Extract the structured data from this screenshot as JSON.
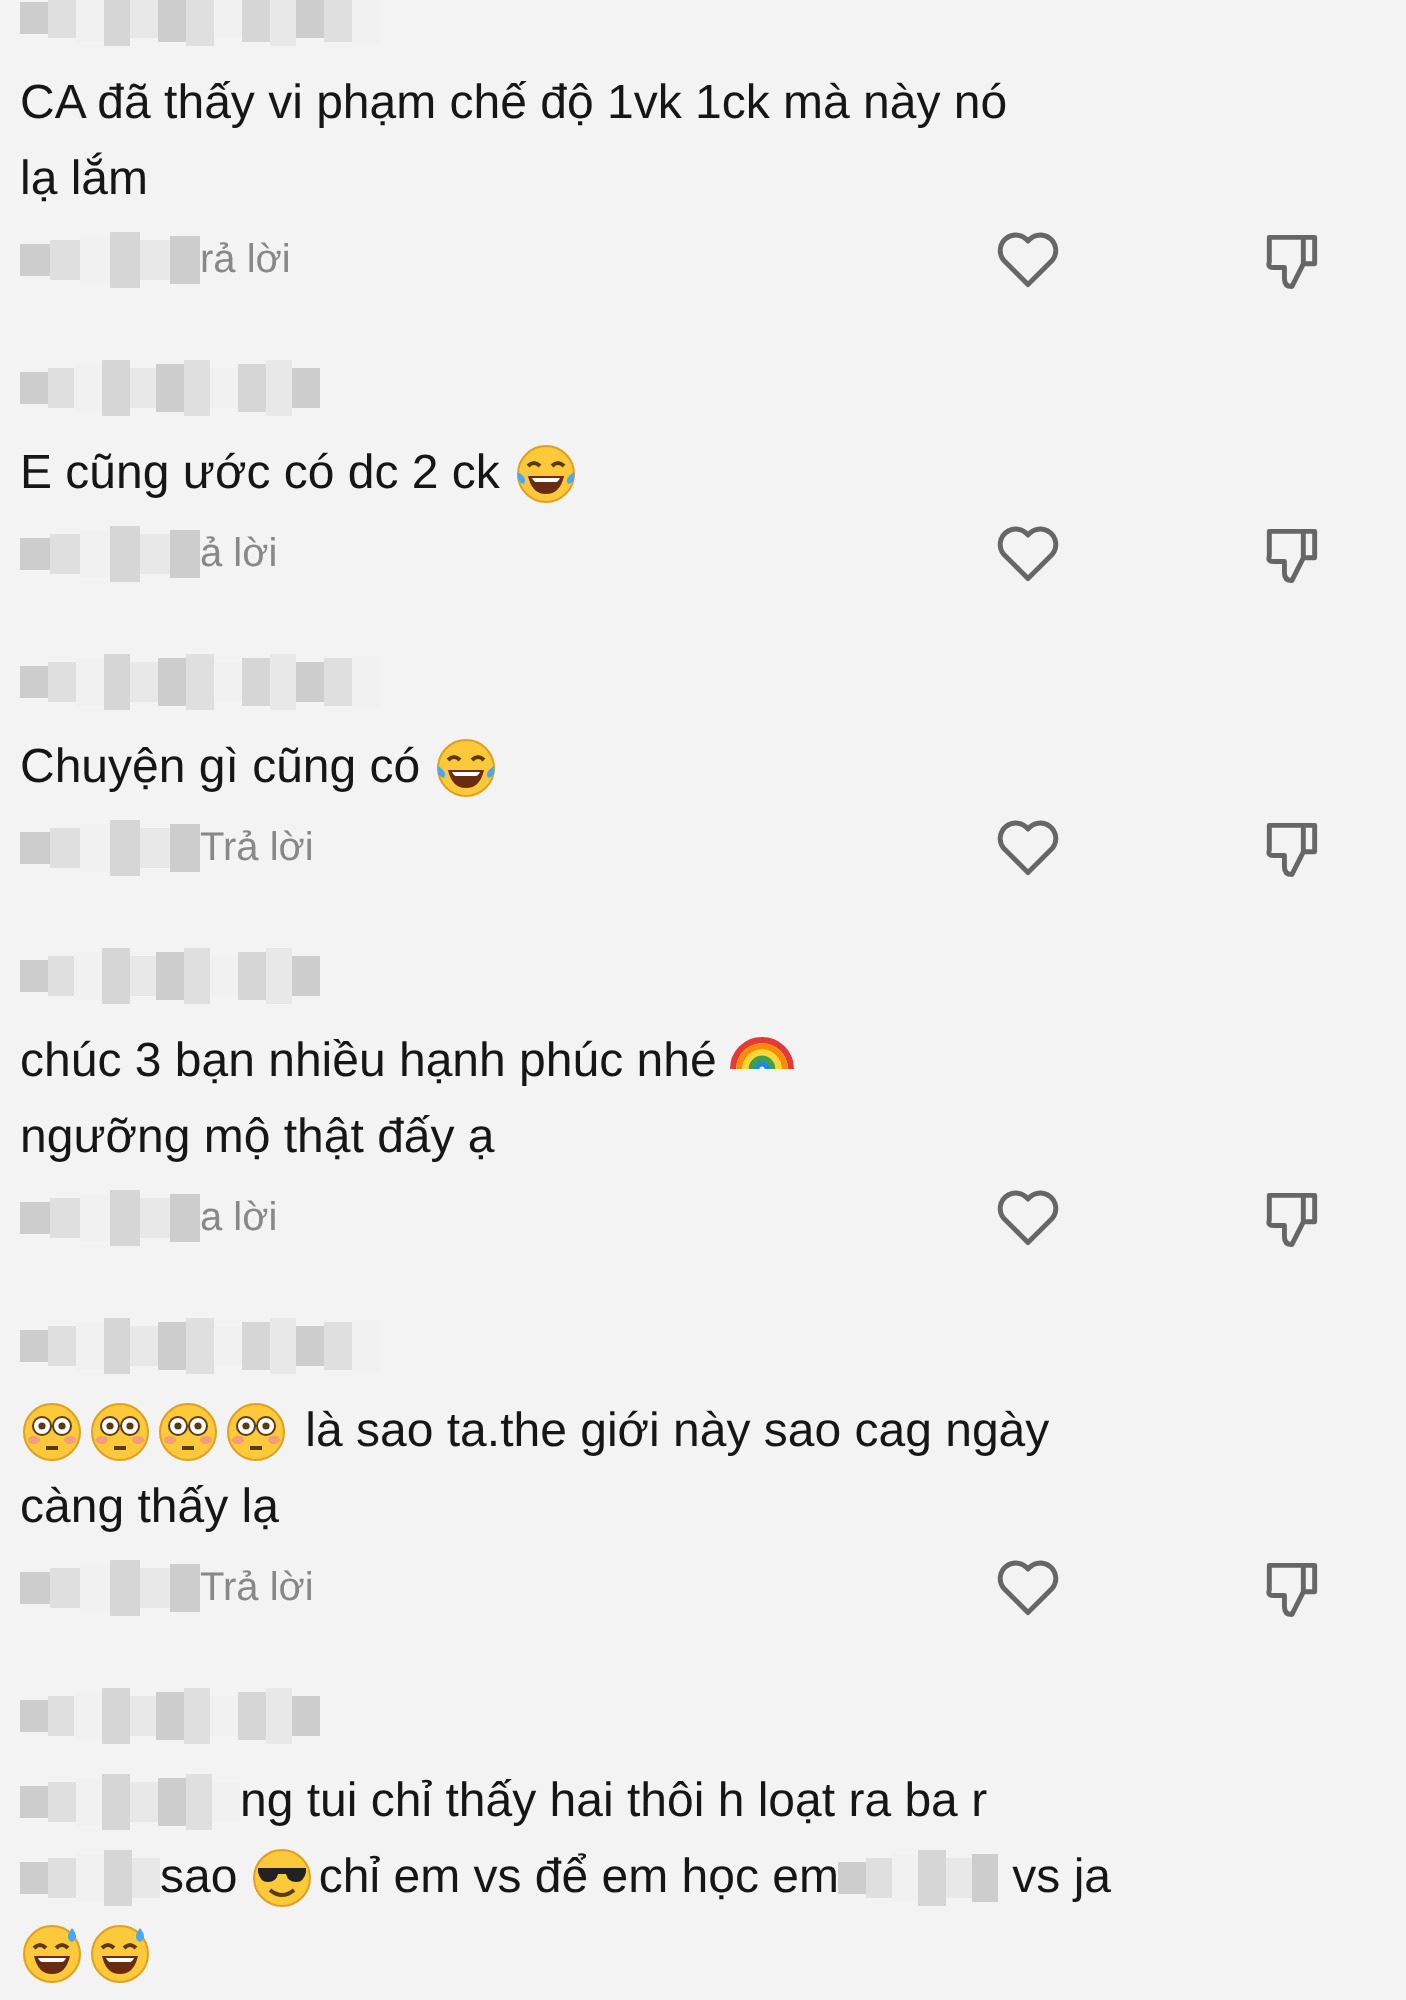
{
  "comments": [
    {
      "lines": [
        [
          {
            "kind": "text",
            "text": "CA đã thấy vi phạm chế độ 1vk 1ck mà này nó"
          }
        ],
        [
          {
            "kind": "text",
            "text": "lạ lắm"
          }
        ]
      ],
      "reply": "rả lời",
      "liked": false,
      "disliked": false
    },
    {
      "lines": [
        [
          {
            "kind": "text",
            "text": "E cũng ước có dc 2 ck "
          },
          {
            "kind": "laugh"
          }
        ]
      ],
      "reply": "ả lời",
      "liked": false,
      "disliked": false
    },
    {
      "lines": [
        [
          {
            "kind": "text",
            "text": "Chuyện gì cũng có "
          },
          {
            "kind": "laugh"
          }
        ]
      ],
      "reply": "Trả lời",
      "liked": false,
      "disliked": false
    },
    {
      "lines": [
        [
          {
            "kind": "text",
            "text": "chúc 3 bạn nhiều hạnh phúc nhé "
          },
          {
            "kind": "rainbow"
          }
        ],
        [
          {
            "kind": "text",
            "text": "ngưỡng mộ thật đấy ạ"
          }
        ]
      ],
      "reply": "a lời",
      "liked": false,
      "disliked": false
    },
    {
      "lines": [
        [
          {
            "kind": "flushed"
          },
          {
            "kind": "flushed"
          },
          {
            "kind": "flushed"
          },
          {
            "kind": "flushed"
          },
          {
            "kind": "text",
            "text": " là sao ta.the giới này sao cag ngày"
          }
        ],
        [
          {
            "kind": "text",
            "text": "càng thấy lạ"
          }
        ]
      ],
      "reply": "Trả lời",
      "liked": false,
      "disliked": false
    },
    {
      "lines": [
        [
          {
            "kind": "redacted"
          },
          {
            "kind": "text",
            "text": "ng tui chỉ thấy hai thôi h loạt ra ba r"
          }
        ],
        [
          {
            "kind": "redacted"
          },
          {
            "kind": "text",
            "text": "sao "
          },
          {
            "kind": "cool"
          },
          {
            "kind": "text",
            "text": "chỉ em vs để em học em"
          },
          {
            "kind": "redacted"
          },
          {
            "kind": "text",
            "text": " vs ja"
          }
        ],
        [
          {
            "kind": "sweat"
          },
          {
            "kind": "sweat"
          }
        ]
      ]
    }
  ]
}
